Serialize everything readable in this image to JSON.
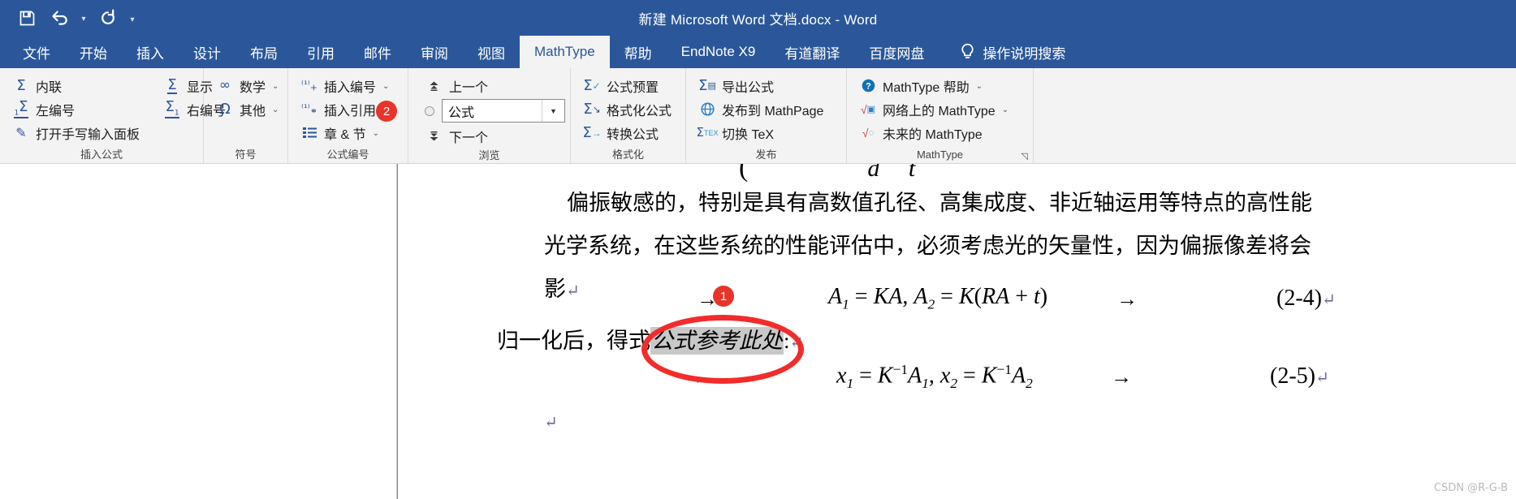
{
  "titlebar": {
    "document_title": "新建 Microsoft Word 文档.docx  -  Word",
    "qat": [
      {
        "name": "save",
        "icon": "save-icon"
      },
      {
        "name": "undo",
        "icon": "undo-icon"
      },
      {
        "name": "redo",
        "icon": "redo-icon"
      },
      {
        "name": "customize-quick-access-toolbar",
        "icon": "chevron-down-icon"
      }
    ]
  },
  "tabs": [
    {
      "label": "文件",
      "active": false
    },
    {
      "label": "开始",
      "active": false
    },
    {
      "label": "插入",
      "active": false
    },
    {
      "label": "设计",
      "active": false
    },
    {
      "label": "布局",
      "active": false
    },
    {
      "label": "引用",
      "active": false
    },
    {
      "label": "邮件",
      "active": false
    },
    {
      "label": "审阅",
      "active": false
    },
    {
      "label": "视图",
      "active": false
    },
    {
      "label": "MathType",
      "active": true
    },
    {
      "label": "帮助",
      "active": false
    },
    {
      "label": "EndNote X9",
      "active": false
    },
    {
      "label": "有道翻译",
      "active": false
    },
    {
      "label": "百度网盘",
      "active": false
    }
  ],
  "tell_me": {
    "label": "操作说明搜索",
    "icon": "lightbulb-icon"
  },
  "ribbon": {
    "groups": [
      {
        "label": "插入公式",
        "columns": [
          [
            {
              "label": "内联",
              "icon": "sigma-inline-icon",
              "dropdown": false
            },
            {
              "label": "左编号",
              "icon": "sigma-left-numbered-icon",
              "dropdown": false
            },
            {
              "label": "打开手写输入面板",
              "icon": "ink-pen-icon",
              "dropdown": false
            }
          ],
          [
            {
              "label": "显示",
              "icon": "sigma-display-icon",
              "dropdown": false
            },
            {
              "label": "右编号",
              "icon": "sigma-right-numbered-icon",
              "dropdown": false
            }
          ]
        ]
      },
      {
        "label": "符号",
        "columns": [
          [
            {
              "label": "数学",
              "icon": "infinity-icon",
              "dropdown": true
            },
            {
              "label": "其他",
              "icon": "omega-icon",
              "dropdown": true
            }
          ]
        ]
      },
      {
        "label": "公式编号",
        "columns": [
          [
            {
              "label": "插入编号",
              "icon": "insert-number-icon",
              "dropdown": true
            },
            {
              "label": "插入引用",
              "icon": "insert-reference-icon",
              "dropdown": false,
              "badge": "2"
            },
            {
              "label": "章 & 节",
              "icon": "chapter-section-icon",
              "dropdown": true
            }
          ]
        ]
      },
      {
        "label": "浏览",
        "columns": [
          [
            {
              "label": "上一个",
              "icon": "previous-icon",
              "dropdown": false
            },
            {
              "type": "combo",
              "name": "browse-object-combo",
              "value": "公式",
              "radio": true
            },
            {
              "label": "下一个",
              "icon": "next-icon",
              "dropdown": false
            }
          ]
        ]
      },
      {
        "label": "格式化",
        "columns": [
          [
            {
              "label": "公式预置",
              "icon": "equation-preferences-icon",
              "dropdown": false
            },
            {
              "label": "格式化公式",
              "icon": "format-equations-icon",
              "dropdown": false
            },
            {
              "label": "转换公式",
              "icon": "convert-equations-icon",
              "dropdown": false
            }
          ]
        ]
      },
      {
        "label": "发布",
        "columns": [
          [
            {
              "label": "导出公式",
              "icon": "export-equations-icon",
              "dropdown": false
            },
            {
              "label": "发布到 MathPage",
              "icon": "globe-icon",
              "dropdown": false
            },
            {
              "label": "切换 TeX",
              "icon": "toggle-tex-icon",
              "dropdown": false
            }
          ]
        ]
      },
      {
        "label": "MathType",
        "has_dialog_launcher": true,
        "columns": [
          [
            {
              "label": "MathType 帮助",
              "icon": "help-circle-icon",
              "dropdown": true
            },
            {
              "label": "网络上的 MathType",
              "icon": "mathtype-web-icon",
              "dropdown": true
            },
            {
              "label": "未来的 MathType",
              "icon": "mathtype-future-icon",
              "dropdown": false
            }
          ]
        ]
      }
    ]
  },
  "document": {
    "clipped_formula_top": "d t",
    "paragraph_lines": [
      "偏振敏感的，特别是具有高数值孔径、高集成度、非近轴运用等特点的高性能",
      "光学系统，在这些系统的性能评估中，必须考虑光的矢量性，因为偏振像差将会",
      "影"
    ],
    "equation_1": {
      "arrow_left": "→",
      "arrow_right": "→",
      "text": "A₁ = KA, A₂ = K(RA + t)",
      "number": "(2-4)",
      "badge": "1"
    },
    "sentence_line": {
      "prefix": "归一化后，得式",
      "field_value": "公式参考此处",
      "suffix": ":"
    },
    "equation_2": {
      "arrow_left": "→",
      "arrow_right": "→",
      "text": "x₁ = K⁻¹A₁, x₂ = K⁻¹A₂",
      "number": "(2-5)"
    },
    "pilcrow": "↵"
  },
  "watermark": "CSDN @R-G-B",
  "colors": {
    "word_blue": "#2b579a",
    "ribbon_bg": "#f3f3f3",
    "accent_icon": "#2b579a",
    "badge_red": "#e8342a",
    "annotation_red": "#f22c2c",
    "field_highlight": "#c8c8c8"
  }
}
